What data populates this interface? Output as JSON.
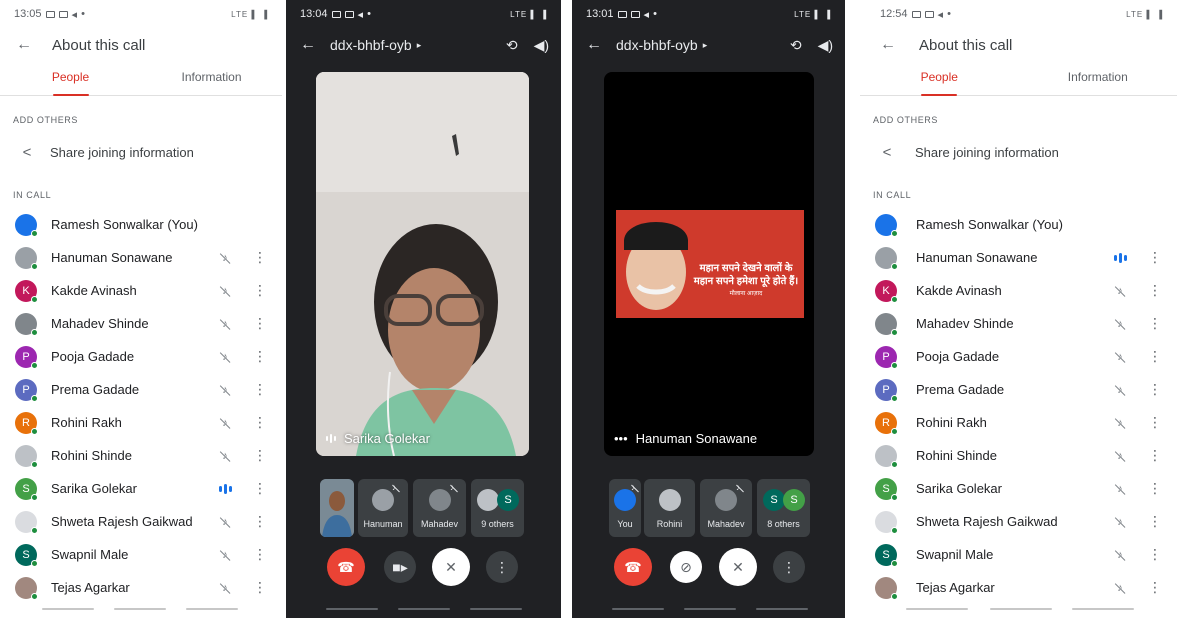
{
  "panel1": {
    "status_time": "13:05",
    "status_right": "LTE ▌ ▐",
    "title": "About this call",
    "tabs": [
      "People",
      "Information"
    ],
    "add_others_label": "ADD OTHERS",
    "share_label": "Share joining information",
    "in_call_label": "IN CALL",
    "participants": [
      {
        "name": "Ramesh Sonwalkar (You)",
        "initial": "",
        "color": "#1a73e8",
        "state": "none"
      },
      {
        "name": "Hanuman Sonawane",
        "initial": "",
        "color": "#9aa0a6",
        "state": "muted"
      },
      {
        "name": "Kakde Avinash",
        "initial": "K",
        "color": "#c2185b",
        "state": "muted"
      },
      {
        "name": "Mahadev Shinde",
        "initial": "",
        "color": "#80868b",
        "state": "muted"
      },
      {
        "name": "Pooja Gadade",
        "initial": "P",
        "color": "#9c27b0",
        "state": "muted"
      },
      {
        "name": "Prema Gadade",
        "initial": "P",
        "color": "#5c6bc0",
        "state": "muted"
      },
      {
        "name": "Rohini Rakh",
        "initial": "R",
        "color": "#e8710a",
        "state": "muted"
      },
      {
        "name": "Rohini Shinde",
        "initial": "",
        "color": "#bdc1c6",
        "state": "muted"
      },
      {
        "name": "Sarika Golekar",
        "initial": "S",
        "color": "#43a047",
        "state": "speaking"
      },
      {
        "name": "Shweta Rajesh Gaikwad",
        "initial": "",
        "color": "#dadce0",
        "state": "muted"
      },
      {
        "name": "Swapnil Male",
        "initial": "S",
        "color": "#00695c",
        "state": "muted"
      },
      {
        "name": "Tejas Agarkar",
        "initial": "",
        "color": "#a1887f",
        "state": "muted"
      }
    ]
  },
  "panel2": {
    "status_time": "13:04",
    "status_right": "LTE ▌ ▐",
    "meeting_code": "ddx-bhbf-oyb",
    "main_name": "Sarika Golekar",
    "thumbs": [
      {
        "label": "Hanuman",
        "initial": "",
        "color": "#9aa0a6"
      },
      {
        "label": "Mahadev",
        "initial": "",
        "color": "#80868b"
      },
      {
        "label": "9 others",
        "initial": "S",
        "color": "#00695c"
      }
    ]
  },
  "panel3": {
    "status_time": "13:01",
    "status_right": "LTE ▌ ▐",
    "meeting_code": "ddx-bhbf-oyb",
    "main_name": "Hanuman Sonawane",
    "poster_line1": "महान सपने देखने वालों के",
    "poster_line2": "महान सपने हमेशा पूरे होते हैं।",
    "poster_sig": "मौलाना आज़ाद",
    "thumbs": [
      {
        "label": "You",
        "initial": "",
        "color": "#1a73e8"
      },
      {
        "label": "Rohini",
        "initial": "",
        "color": "#bdc1c6"
      },
      {
        "label": "Mahadev",
        "initial": "",
        "color": "#80868b"
      },
      {
        "label": "8 others",
        "initial": "S",
        "color": "#43a047"
      }
    ]
  },
  "panel4": {
    "status_time": "12:54",
    "status_right": "LTE ▌ ▐",
    "title": "About this call",
    "tabs": [
      "People",
      "Information"
    ],
    "add_others_label": "ADD OTHERS",
    "share_label": "Share joining information",
    "in_call_label": "IN CALL",
    "participants": [
      {
        "name": "Ramesh Sonwalkar (You)",
        "initial": "",
        "color": "#1a73e8",
        "state": "none"
      },
      {
        "name": "Hanuman Sonawane",
        "initial": "",
        "color": "#9aa0a6",
        "state": "speaking"
      },
      {
        "name": "Kakde Avinash",
        "initial": "K",
        "color": "#c2185b",
        "state": "muted"
      },
      {
        "name": "Mahadev Shinde",
        "initial": "",
        "color": "#80868b",
        "state": "muted"
      },
      {
        "name": "Pooja Gadade",
        "initial": "P",
        "color": "#9c27b0",
        "state": "muted"
      },
      {
        "name": "Prema Gadade",
        "initial": "P",
        "color": "#5c6bc0",
        "state": "muted"
      },
      {
        "name": "Rohini Rakh",
        "initial": "R",
        "color": "#e8710a",
        "state": "muted"
      },
      {
        "name": "Rohini Shinde",
        "initial": "",
        "color": "#bdc1c6",
        "state": "muted"
      },
      {
        "name": "Sarika Golekar",
        "initial": "S",
        "color": "#43a047",
        "state": "muted"
      },
      {
        "name": "Shweta Rajesh Gaikwad",
        "initial": "",
        "color": "#dadce0",
        "state": "muted"
      },
      {
        "name": "Swapnil Male",
        "initial": "S",
        "color": "#00695c",
        "state": "muted"
      },
      {
        "name": "Tejas Agarkar",
        "initial": "",
        "color": "#a1887f",
        "state": "muted"
      }
    ]
  }
}
